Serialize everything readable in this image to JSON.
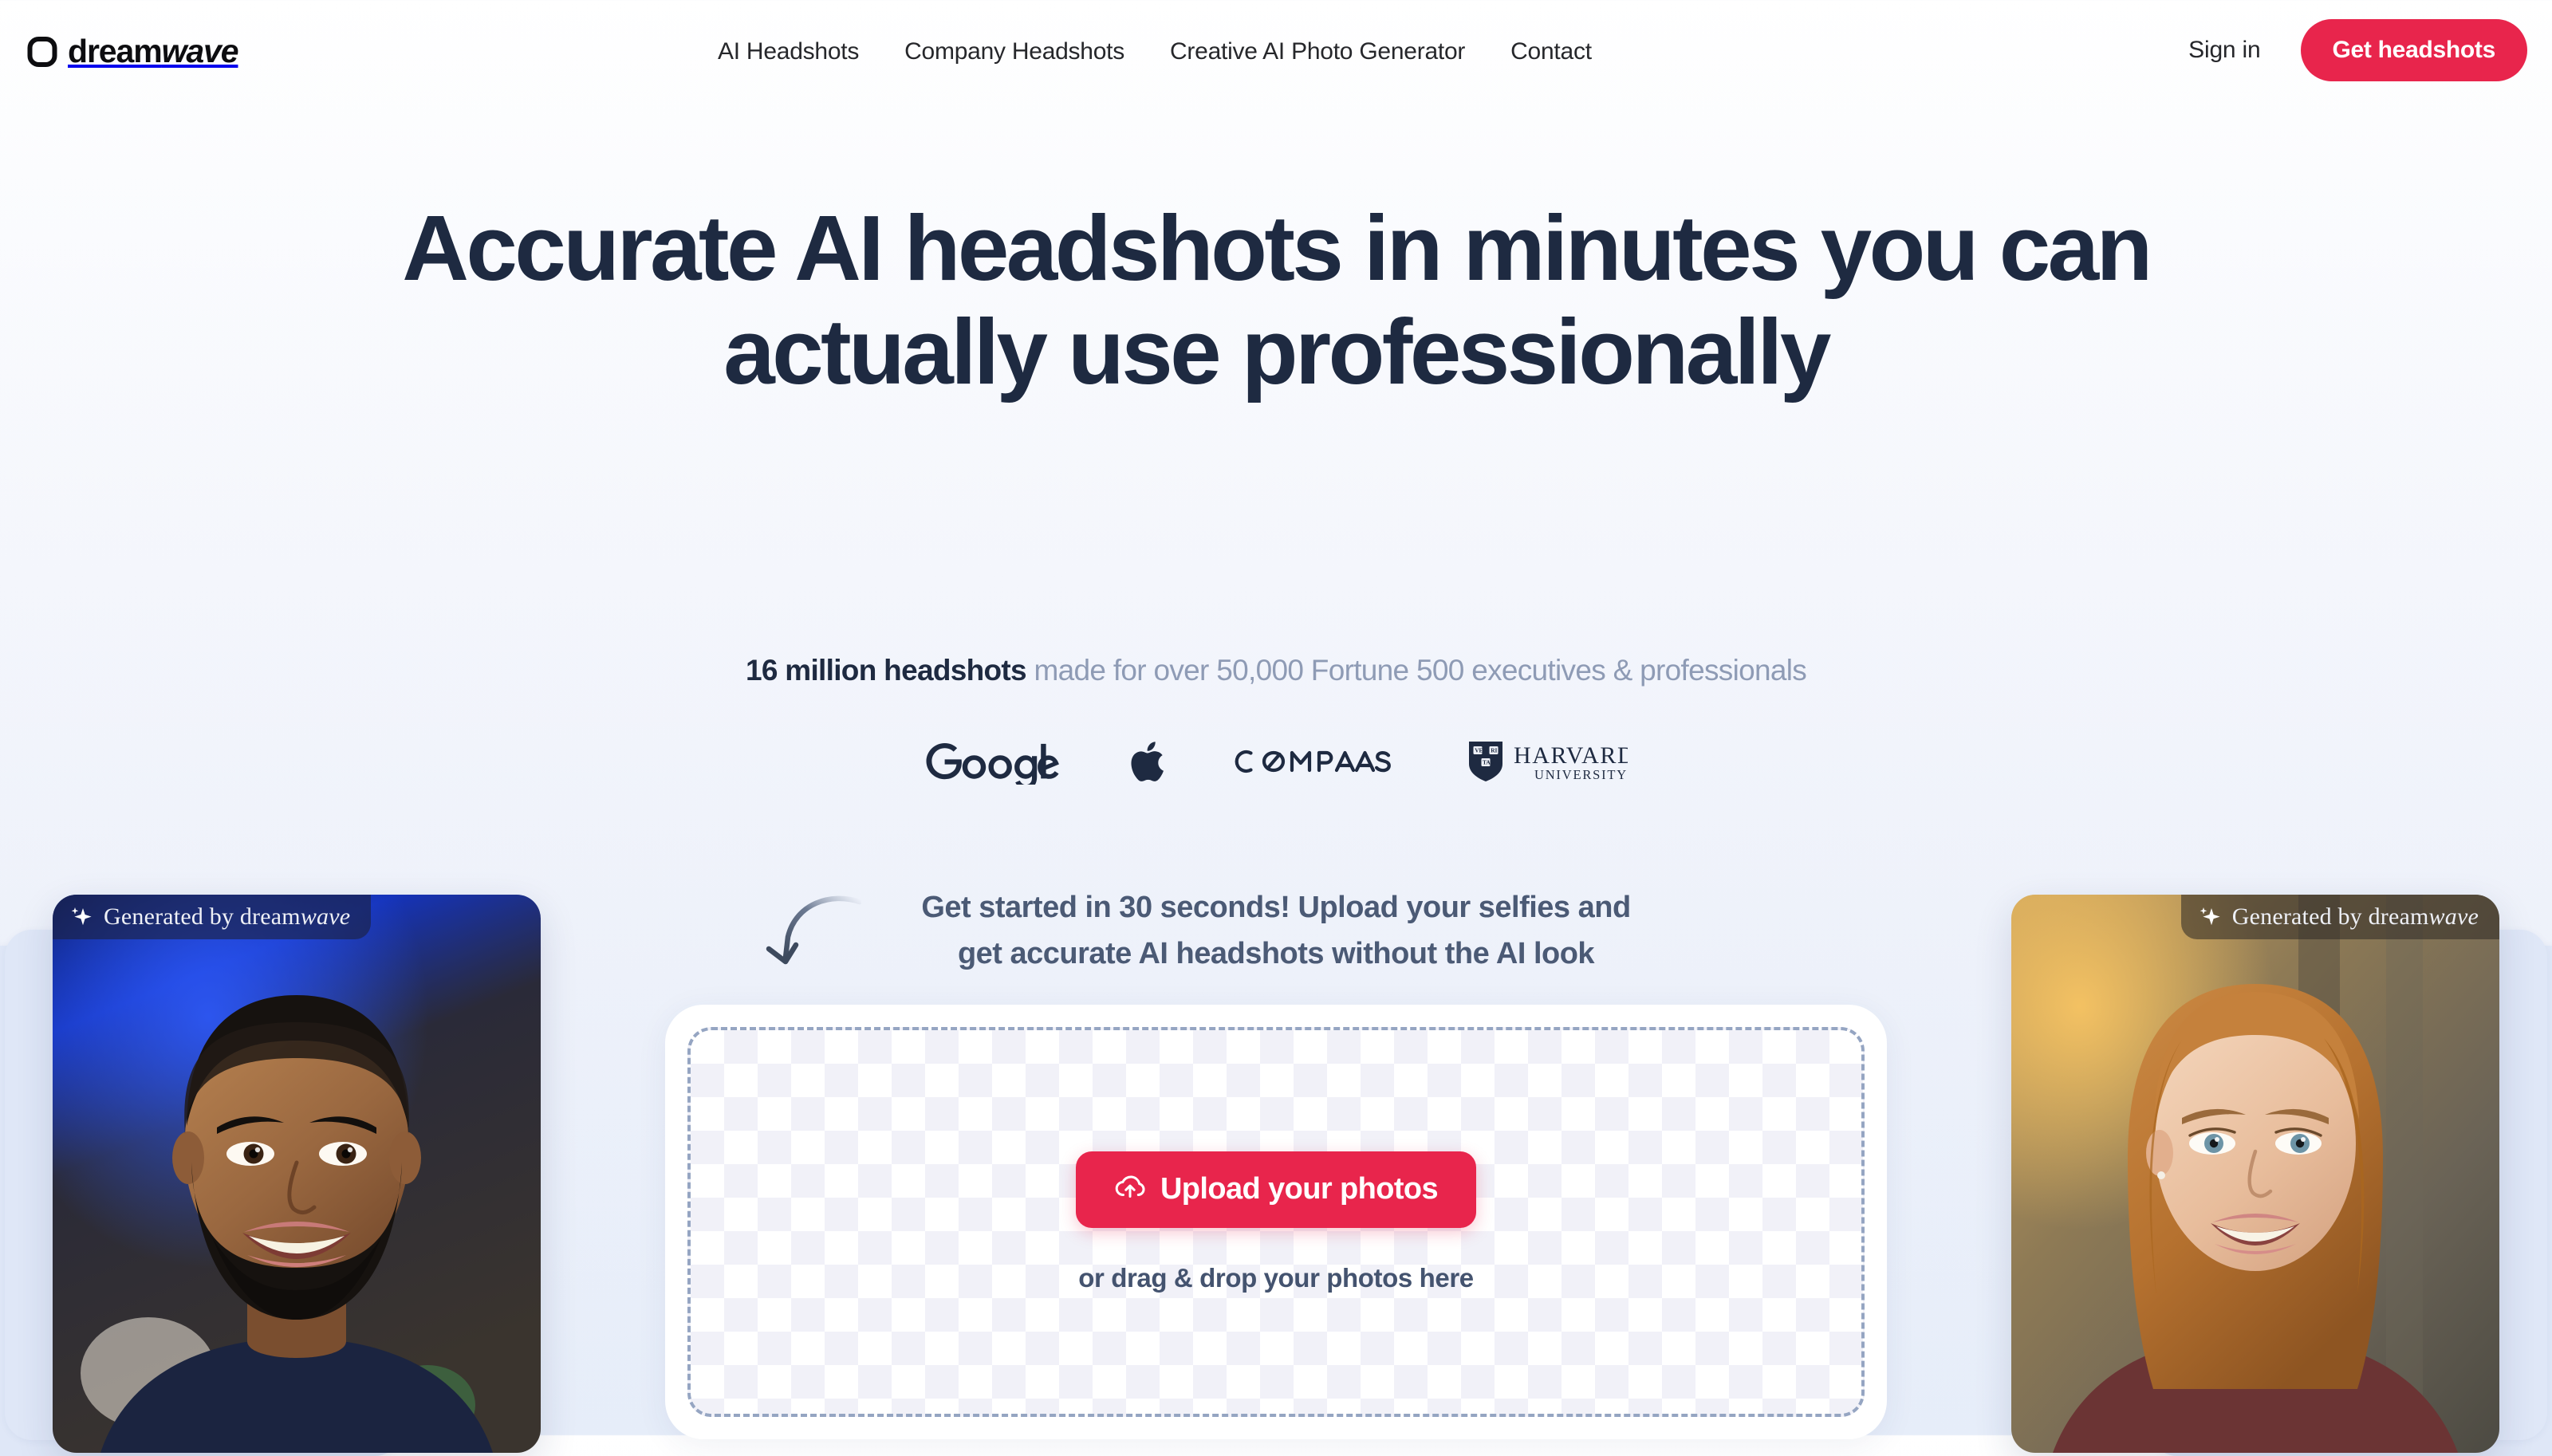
{
  "brand": {
    "name_bold": "dream",
    "name_italic": "wave",
    "icon": "squircle-logo-icon"
  },
  "nav": {
    "links": [
      {
        "label": "AI Headshots"
      },
      {
        "label": "Company Headshots"
      },
      {
        "label": "Creative AI Photo Generator"
      },
      {
        "label": "Contact"
      }
    ],
    "signin_label": "Sign in",
    "cta_label": "Get headshots"
  },
  "hero": {
    "headline": "Accurate AI headshots in minutes you can actually use professionally",
    "subline_strong": "16 million headshots",
    "subline_rest": " made for over 50,000 Fortune 500 executives & professionals"
  },
  "logos": [
    {
      "name": "google-logo",
      "label": "Google"
    },
    {
      "name": "apple-logo",
      "label": "Apple"
    },
    {
      "name": "compass-logo",
      "label": "CØMPASS"
    },
    {
      "name": "harvard-logo",
      "label": "HARVARD UNIVERSITY"
    }
  ],
  "upload": {
    "copy_line1": "Get started in 30 seconds! Upload your selfies and",
    "copy_line2": "get accurate AI headshots without the AI look",
    "button_label": "Upload your photos",
    "drop_hint": "or drag & drop your photos here",
    "button_icon": "cloud-upload-icon"
  },
  "showcase": {
    "badge_prefix": "Generated by dream",
    "badge_italic": "wave",
    "badge_icon": "sparkle-icon",
    "left_alt": "smiling man headshot",
    "right_alt": "smiling woman headshot"
  },
  "colors": {
    "accent": "#E8254C",
    "headline": "#1e2a41",
    "muted": "#8e9bb5",
    "body": "#4b5a75",
    "page_bg_top": "#ffffff",
    "page_bg_bottom": "#e6edf9"
  }
}
